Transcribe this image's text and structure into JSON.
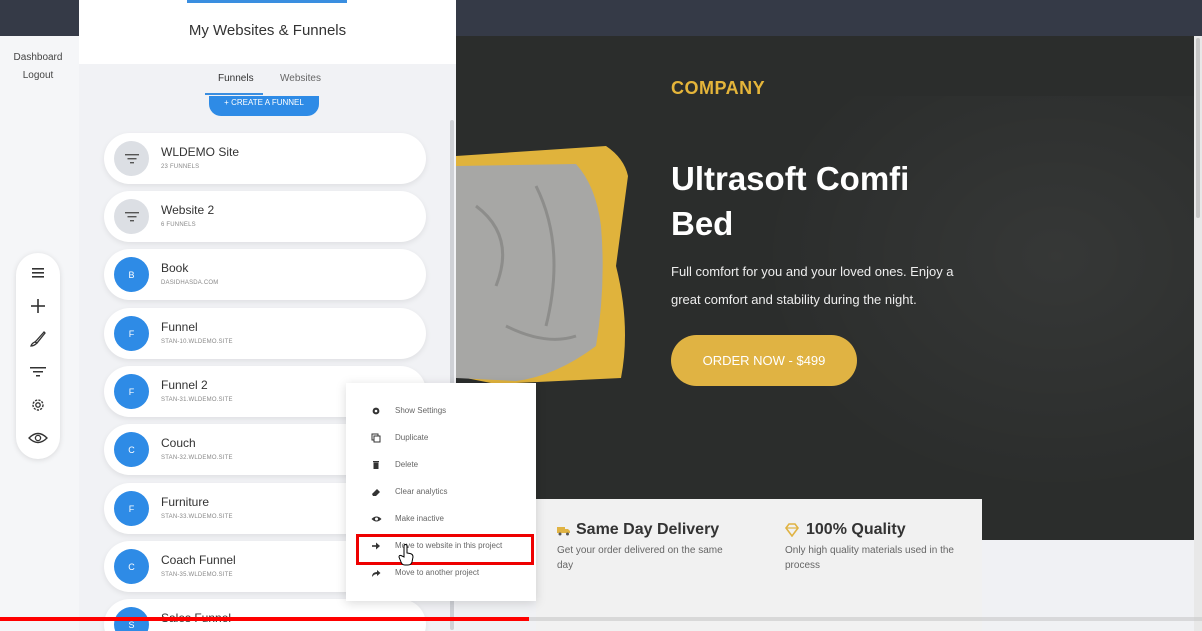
{
  "left_nav": {
    "links": [
      "Dashboard",
      "Logout"
    ],
    "tools": [
      "menu-icon",
      "plus-icon",
      "brush-icon",
      "filter-icon",
      "gear-icon",
      "eye-icon"
    ]
  },
  "panel": {
    "title": "My Websites & Funnels",
    "tabs": [
      {
        "label": "Funnels",
        "active": true
      },
      {
        "label": "Websites",
        "active": false
      }
    ],
    "create_button": "+ CREATE A FUNNEL",
    "items": [
      {
        "name": "WLDEMO Site",
        "sub": "23 FUNNELS",
        "avatar": "",
        "icon": "filter-icon"
      },
      {
        "name": "Website 2",
        "sub": "6 FUNNELS",
        "avatar": "",
        "icon": "filter-icon"
      },
      {
        "name": "Book",
        "sub": "DASIDHASDA.COM",
        "avatar": "B"
      },
      {
        "name": "Funnel",
        "sub": "STAN-10.WLDEMO.SITE",
        "avatar": "F"
      },
      {
        "name": "Funnel 2",
        "sub": "STAN-31.WLDEMO.SITE",
        "avatar": "F"
      },
      {
        "name": "Couch",
        "sub": "STAN-32.WLDEMO.SITE",
        "avatar": "C"
      },
      {
        "name": "Furniture",
        "sub": "STAN-33.WLDEMO.SITE",
        "avatar": "F"
      },
      {
        "name": "Coach Funnel",
        "sub": "STAN-35.WLDEMO.SITE",
        "avatar": "C"
      },
      {
        "name": "Sales Funnel",
        "sub": "",
        "avatar": "S"
      }
    ]
  },
  "context_menu": {
    "items": [
      {
        "label": "Show Settings",
        "icon": "gear-icon"
      },
      {
        "label": "Duplicate",
        "icon": "copy-icon"
      },
      {
        "label": "Delete",
        "icon": "trash-icon"
      },
      {
        "label": "Clear analytics",
        "icon": "eraser-icon"
      },
      {
        "label": "Make inactive",
        "icon": "eye-off-icon"
      },
      {
        "label": "Move to website in this project",
        "icon": "arrow-right-icon"
      },
      {
        "label": "Move to another project",
        "icon": "share-icon"
      }
    ],
    "highlighted_index": 5
  },
  "preview": {
    "company": "COMPANY",
    "title": "Ultrasoft Comfi Bed",
    "description": "Full comfort for you and your loved ones. Enjoy a great comfort and stability during the night.",
    "order_button": "ORDER NOW - $499",
    "features": [
      {
        "title": "Same Day Delivery",
        "desc": "Get your order delivered on the same day",
        "icon": "truck-icon"
      },
      {
        "title": "100% Quality",
        "desc": "Only high quality materials used in the process",
        "icon": "diamond-icon"
      }
    ]
  },
  "colors": {
    "accent_blue": "#2e8be6",
    "brand_gold": "#e0b343",
    "preview_bg": "#2b2d2c",
    "highlight_red": "#ee0000"
  },
  "video": {
    "progress": 0.44
  }
}
